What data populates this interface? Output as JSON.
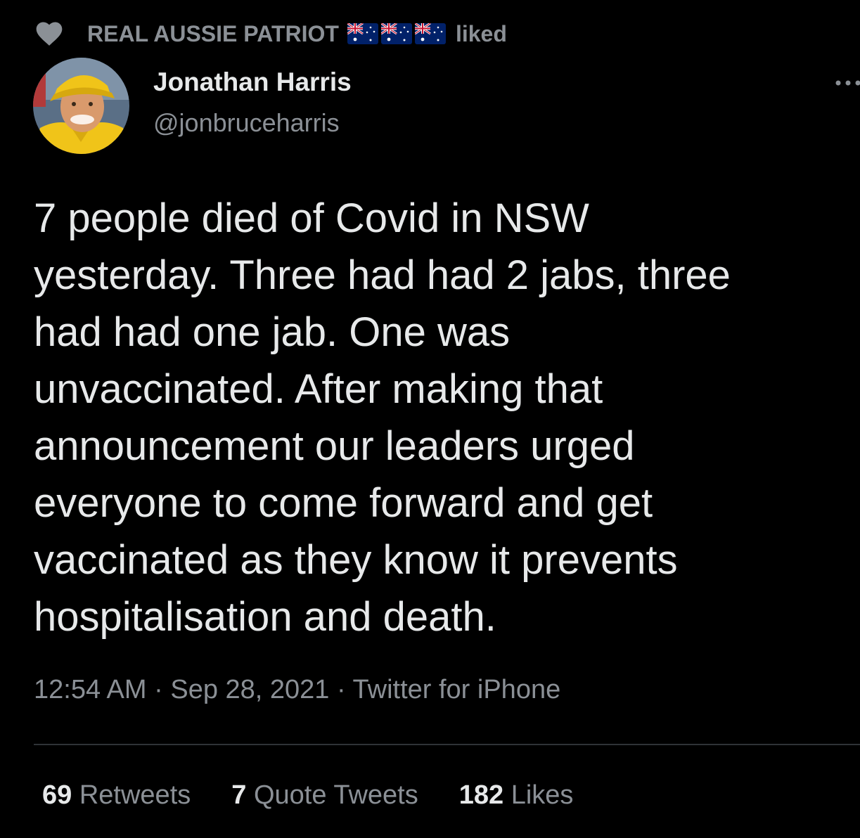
{
  "social_context": {
    "icon": "heart-icon",
    "user": "REAL AUSSIE PATRIOT",
    "emoji_flags": [
      "australia-flag-icon",
      "australia-flag-icon",
      "australia-flag-icon"
    ],
    "action": "liked"
  },
  "tweet": {
    "author": {
      "display_name": "Jonathan Harris",
      "handle": "@jonbruceharris",
      "avatar": "avatar-photo"
    },
    "text_lines": [
      "7 people died of Covid in NSW",
      "yesterday. Three had had 2 jabs, three",
      "had had one jab. One was",
      "unvaccinated. After making that",
      "announcement our leaders urged",
      "everyone to come forward and get",
      "vaccinated as they know it prevents",
      "hospitalisation and death."
    ],
    "time": "12:54 AM",
    "date": "Sep 28, 2021",
    "source": "Twitter for iPhone",
    "separator": "·"
  },
  "stats": {
    "retweets": {
      "count": "69",
      "label": "Retweets"
    },
    "quote_tweets": {
      "count": "7",
      "label": "Quote Tweets"
    },
    "likes": {
      "count": "182",
      "label": "Likes"
    }
  },
  "colors": {
    "background": "#000000",
    "primary_text": "#e7e9ea",
    "secondary_text": "#8b9096",
    "divider": "#2f3336"
  }
}
